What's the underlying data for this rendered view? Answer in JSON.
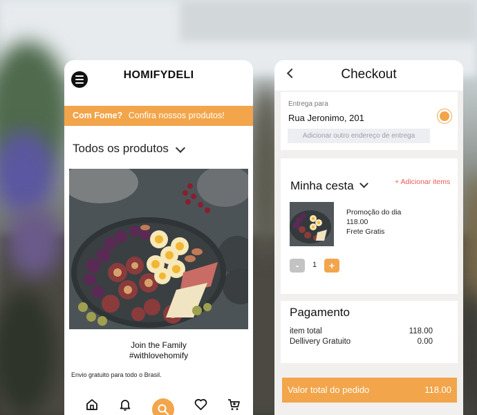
{
  "left_app": {
    "brand": "HOMIFYDELI",
    "promo": {
      "highlight": "Com Fome?",
      "text": "Confira nossos produtos!"
    },
    "products_title": "Todos os produtos",
    "join_line1": "Join the Family",
    "join_line2": "#withlovehomify",
    "shipping_note": "Envio gratuito para todo o Brasil.",
    "nav": [
      "home-icon",
      "bell-icon",
      "search-icon",
      "heart-icon",
      "cart-icon"
    ]
  },
  "checkout": {
    "title": "Checkout",
    "delivery_label": "Entrega para",
    "address": "Rua Jeronimo, 201",
    "add_address": "Adicionar outro endereço de entrega",
    "basket_title": "Minha cesta",
    "add_items": "+ Adicionar items",
    "item": {
      "name": "Promoção do dia",
      "price": "118.00",
      "shipping": "Frete Gratis"
    },
    "quantity": "1",
    "minus": "-",
    "plus": "+",
    "payment_title": "Pagamento",
    "rows": [
      {
        "label": "item total",
        "value": "118.00"
      },
      {
        "label": "Dellivery Gratuito",
        "value": "0.00"
      }
    ],
    "total_label": "Valor total do pedido",
    "total_value": "118.00"
  },
  "colors": {
    "accent": "#f2a54a",
    "add_items": "#e85a55"
  }
}
